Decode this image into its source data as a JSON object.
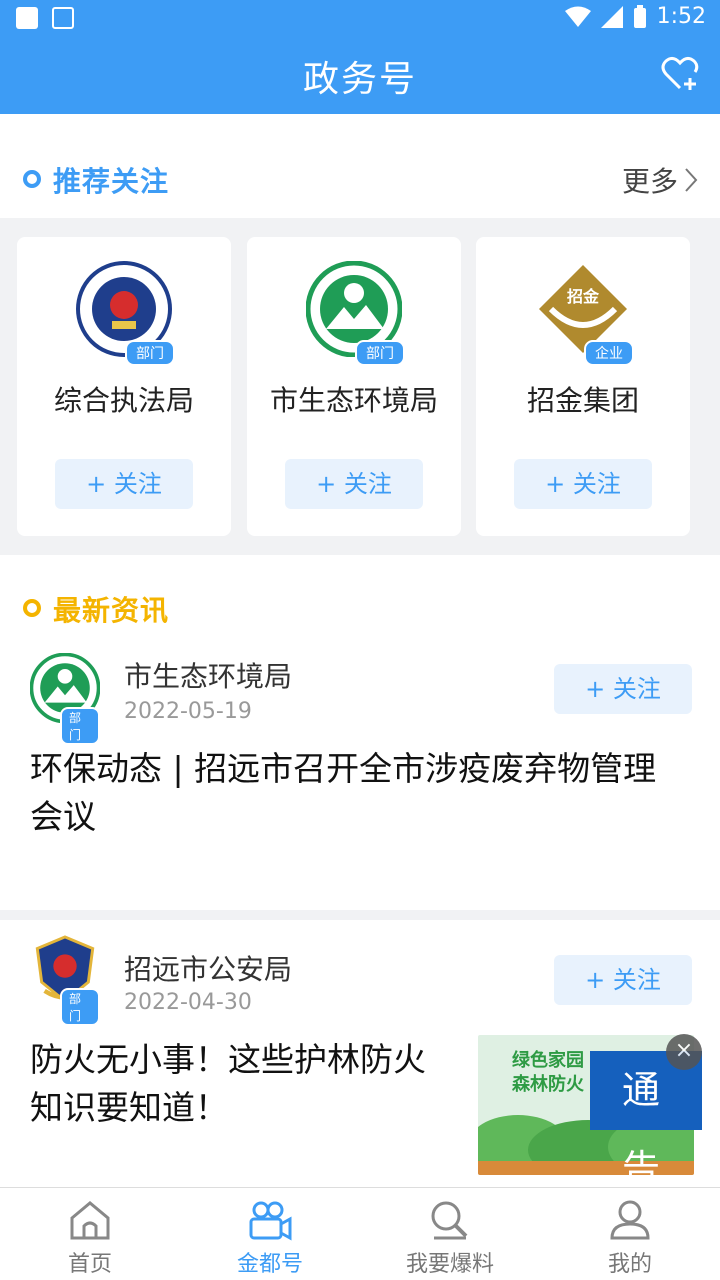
{
  "status_bar": {
    "time": "1:52"
  },
  "app_bar": {
    "title": "政务号"
  },
  "recommend": {
    "title": "推荐关注",
    "more": "更多",
    "cards": [
      {
        "name": "综合执法局",
        "tag": "部门",
        "follow": "+ 关注"
      },
      {
        "name": "市生态环境局",
        "tag": "部门",
        "follow": "+ 关注"
      },
      {
        "name": "招金集团",
        "tag": "企业",
        "follow": "+ 关注",
        "logo_text": "招金"
      }
    ]
  },
  "news": {
    "title": "最新资讯",
    "items": [
      {
        "author": "市生态环境局",
        "tag": "部门",
        "date": "2022-05-19",
        "follow": "+ 关注",
        "headline": "环保动态 | 招远市召开全市涉疫废弃物管理会议"
      },
      {
        "author": "招远市公安局",
        "tag": "部门",
        "date": "2022-04-30",
        "follow": "+ 关注",
        "headline": "防火无小事！这些护林防火知识要知道！",
        "thumb_text": "绿色家园\n森林防火"
      }
    ]
  },
  "notice": {
    "label": "通 告",
    "close": "×"
  },
  "tabs": [
    {
      "label": "首页",
      "icon": "home-icon"
    },
    {
      "label": "金都号",
      "icon": "video-camera-icon",
      "active": true
    },
    {
      "label": "我要爆料",
      "icon": "search-report-icon"
    },
    {
      "label": "我的",
      "icon": "user-icon"
    }
  ],
  "colors": {
    "primary": "#3d9cf5",
    "recommend_dot": "#3d9cf5",
    "news_dot": "#f4b400",
    "news_title": "#f4b400",
    "notice": "#1560bd"
  }
}
